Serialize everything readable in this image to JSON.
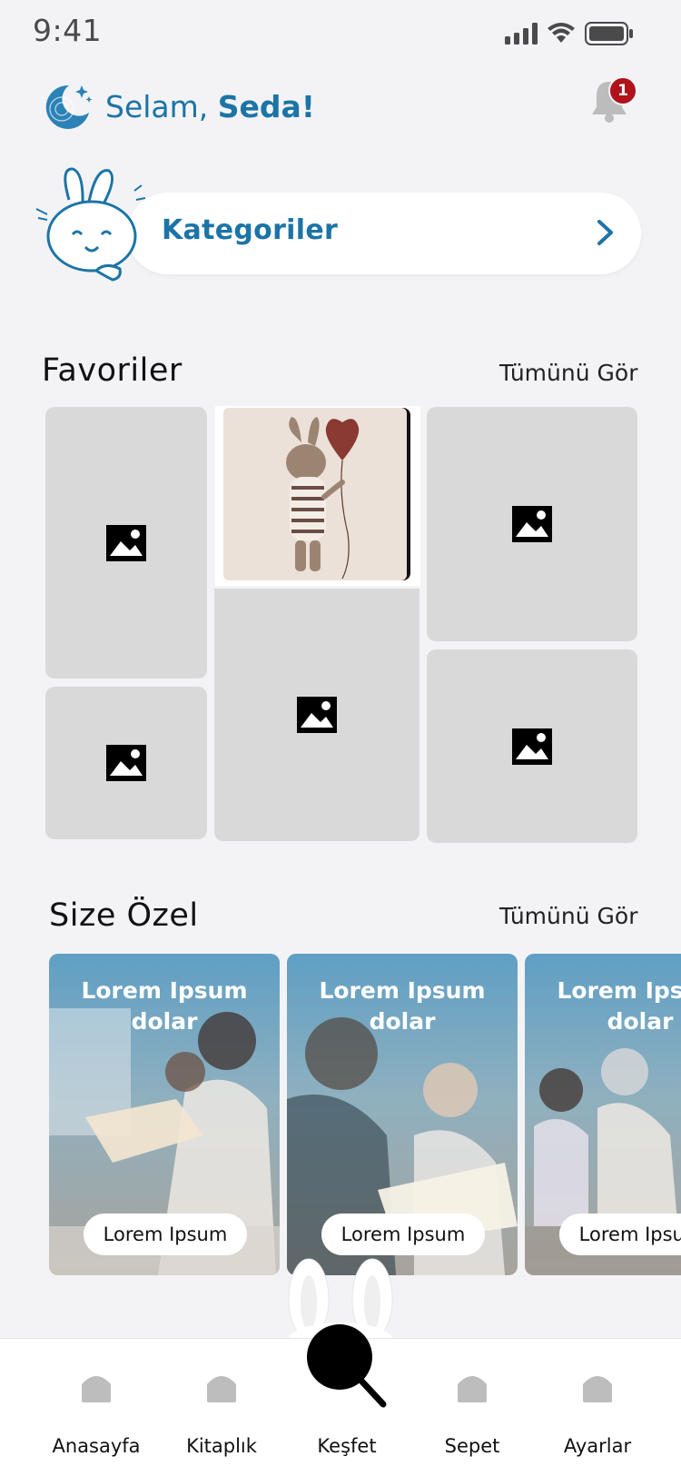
{
  "status_bar": {
    "time": "9:41"
  },
  "header": {
    "greeting_prefix": "Selam,",
    "greeting_name": "Seda!",
    "notification_count": "1"
  },
  "categories": {
    "label": "Kategoriler"
  },
  "favorites": {
    "title": "Favoriler",
    "see_all": "Tümünü Gör"
  },
  "special": {
    "title": "Size Özel",
    "see_all": "Tümünü Gör",
    "cards": [
      {
        "title": "Lorem Ipsum dolar",
        "button": "Lorem Ipsum"
      },
      {
        "title": "Lorem Ipsum dolar",
        "button": "Lorem Ipsum"
      },
      {
        "title": "Lorem Ipsum dolar",
        "button": "Lorem Ipsum"
      }
    ]
  },
  "nav": {
    "items": [
      {
        "label": "Anasayfa"
      },
      {
        "label": "Kitaplık"
      },
      {
        "label": "Keşfet"
      },
      {
        "label": "Sepet"
      },
      {
        "label": "Ayarlar"
      }
    ]
  },
  "colors": {
    "accent": "#1c74a6",
    "badge": "#b0121b",
    "placeholder": "#d9d9d9",
    "background": "#f3f3f6"
  }
}
